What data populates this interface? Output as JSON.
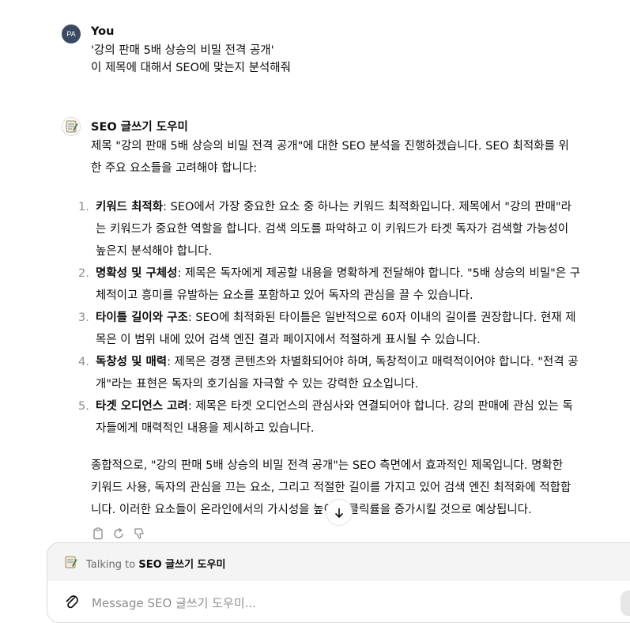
{
  "user": {
    "avatar_initials": "PA",
    "name": "You",
    "line1": "'강의 판매 5배 상승의 비밀 전격 공개'",
    "line2": "이 제목에 대해서 SEO에 맞는지 분석해줘"
  },
  "bot": {
    "name": "SEO 글쓰기 도우미",
    "intro": "제목 \"강의 판매 5배 상승의 비밀 전격 공개\"에 대한 SEO 분석을 진행하겠습니다. SEO 최적화를 위한 주요 요소들을 고려해야 합니다:",
    "items": [
      {
        "num": "1.",
        "title": "키워드 최적화",
        "body": ": SEO에서 가장 중요한 요소 중 하나는 키워드 최적화입니다. 제목에서 \"강의 판매\"라는 키워드가 중요한 역할을 합니다. 검색 의도를 파악하고 이 키워드가 타겟 독자가 검색할 가능성이 높은지 분석해야 합니다."
      },
      {
        "num": "2.",
        "title": "명확성 및 구체성",
        "body": ": 제목은 독자에게 제공할 내용을 명확하게 전달해야 합니다. \"5배 상승의 비밀\"은 구체적이고 흥미를 유발하는 요소를 포함하고 있어 독자의 관심을 끌 수 있습니다."
      },
      {
        "num": "3.",
        "title": "타이틀 길이와 구조",
        "body": ": SEO에 최적화된 타이틀은 일반적으로 60자 이내의 길이를 권장합니다. 현재 제목은 이 범위 내에 있어 검색 엔진 결과 페이지에서 적절하게 표시될 수 있습니다."
      },
      {
        "num": "4.",
        "title": "독창성 및 매력",
        "body": ": 제목은 경쟁 콘텐츠와 차별화되어야 하며, 독창적이고 매력적이어야 합니다. \"전격 공개\"라는 표현은 독자의 호기심을 자극할 수 있는 강력한 요소입니다."
      },
      {
        "num": "5.",
        "title": "타겟 오디언스 고려",
        "body": ": 제목은 타겟 오디언스의 관심사와 연결되어야 합니다. 강의 판매에 관심 있는 독자들에게 매력적인 내용을 제시하고 있습니다."
      }
    ],
    "conclusion": "종합적으로, \"강의 판매 5배 상승의 비밀 전격 공개\"는 SEO 측면에서 효과적인 제목입니다. 명확한 키워드 사용, 독자의 관심을 끄는 요소, 그리고 적절한 길이를 가지고 있어 검색 엔진 최적화에 적합합니다. 이러한 요소들이 온라인에서의 가시성을 높이고 클릭률을 증가시킬 것으로 예상됩니다."
  },
  "composer": {
    "talking_prefix": "Talking to ",
    "talking_name": "SEO 글쓰기 도우미",
    "placeholder": "Message SEO 글쓰기 도우미..."
  },
  "icons": {
    "copy": "clipboard-icon",
    "regenerate": "regenerate-icon",
    "dislike": "thumbs-down-icon",
    "scroll": "arrow-down-icon",
    "attach": "paperclip-icon"
  }
}
